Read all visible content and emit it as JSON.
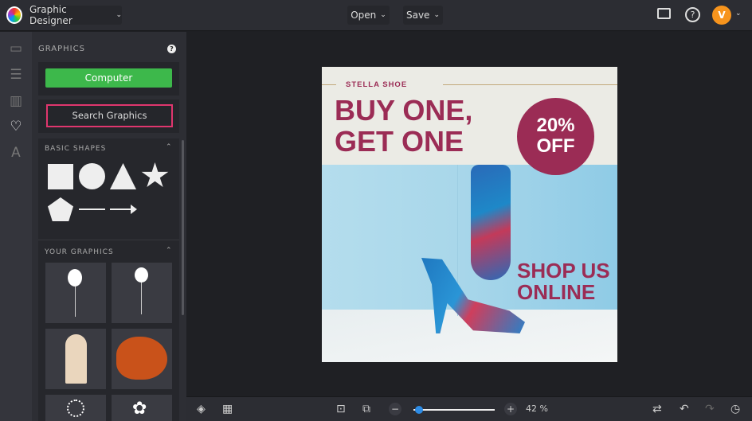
{
  "topbar": {
    "app_menu": "Graphic Designer",
    "open": "Open",
    "save": "Save",
    "avatar": "V"
  },
  "panel": {
    "title": "GRAPHICS",
    "computer": "Computer",
    "search": "Search Graphics",
    "basic_shapes": "BASIC SHAPES",
    "your_graphics": "YOUR GRAPHICS"
  },
  "poster": {
    "brand": "STELLA SHOE",
    "headline1": "BUY ONE,",
    "headline2": "GET ONE",
    "badge1": "20%",
    "badge2": "OFF",
    "cta1": "SHOP US",
    "cta2": "ONLINE"
  },
  "bottom": {
    "zoom": "42 %",
    "zoom_fraction": 0.1
  },
  "colors": {
    "accent_green": "#3db84b",
    "highlight": "#e0366e",
    "brand": "#9b2c55",
    "avatar": "#f7941d"
  }
}
